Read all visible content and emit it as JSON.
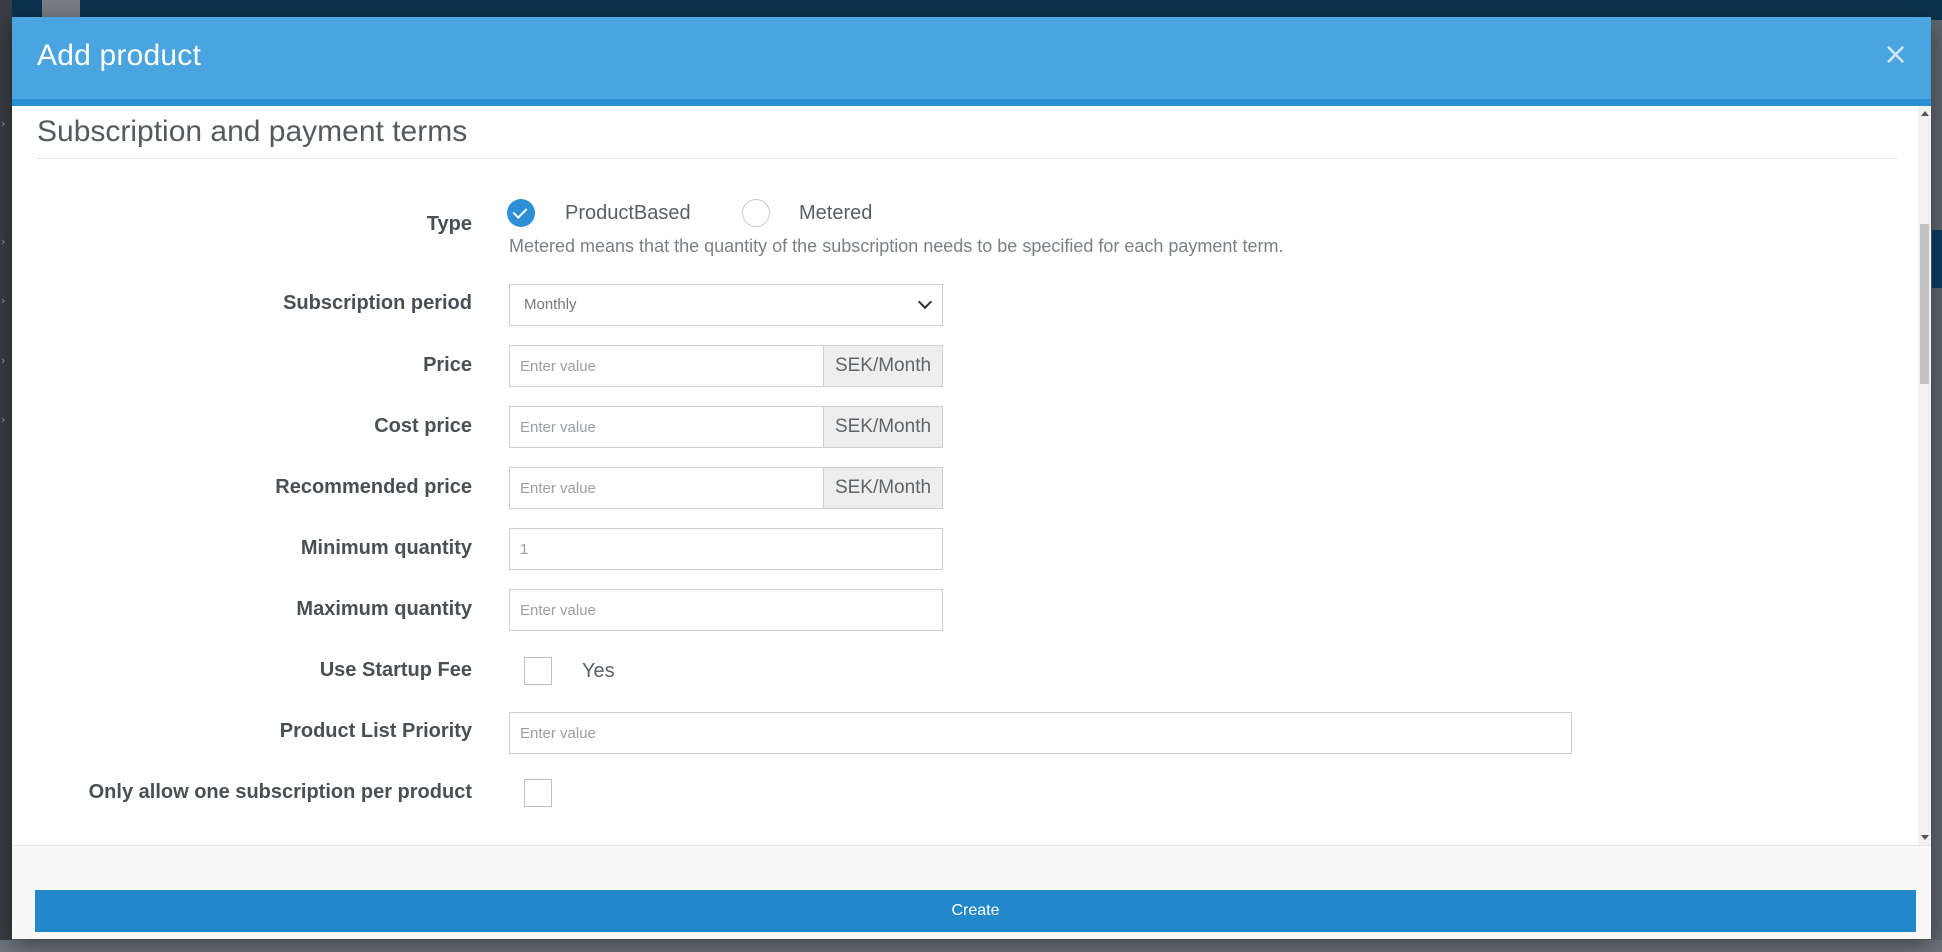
{
  "modal": {
    "title": "Add product",
    "close_symbol": "×"
  },
  "section": {
    "title": "Subscription and payment terms"
  },
  "type_field": {
    "label": "Type",
    "options": [
      {
        "label": "ProductBased",
        "selected": true
      },
      {
        "label": "Metered",
        "selected": false
      }
    ],
    "help_text": "Metered means that the quantity of the subscription needs to be specified for each payment term."
  },
  "subscription_period": {
    "label": "Subscription period",
    "value": "Monthly"
  },
  "price": {
    "label": "Price",
    "placeholder": "Enter value",
    "unit": "SEK/Month"
  },
  "cost_price": {
    "label": "Cost price",
    "placeholder": "Enter value",
    "unit": "SEK/Month"
  },
  "recommended_price": {
    "label": "Recommended price",
    "placeholder": "Enter value",
    "unit": "SEK/Month"
  },
  "minimum_quantity": {
    "label": "Minimum quantity",
    "value": "1"
  },
  "maximum_quantity": {
    "label": "Maximum quantity",
    "placeholder": "Enter value"
  },
  "startup_fee": {
    "label": "Use Startup Fee",
    "checkbox_label": "Yes",
    "checked": false
  },
  "product_list_priority": {
    "label": "Product List Priority",
    "placeholder": "Enter value"
  },
  "one_subscription": {
    "label": "Only allow one subscription per product",
    "checked": false
  },
  "footer": {
    "create_label": "Create"
  },
  "colors": {
    "header": "#4aa4df",
    "primary": "#2388c9",
    "radio_checked": "#2d8fd5"
  },
  "icons": {
    "close": "close-icon",
    "select": "chevron-down-icon",
    "radio": "check-icon"
  }
}
